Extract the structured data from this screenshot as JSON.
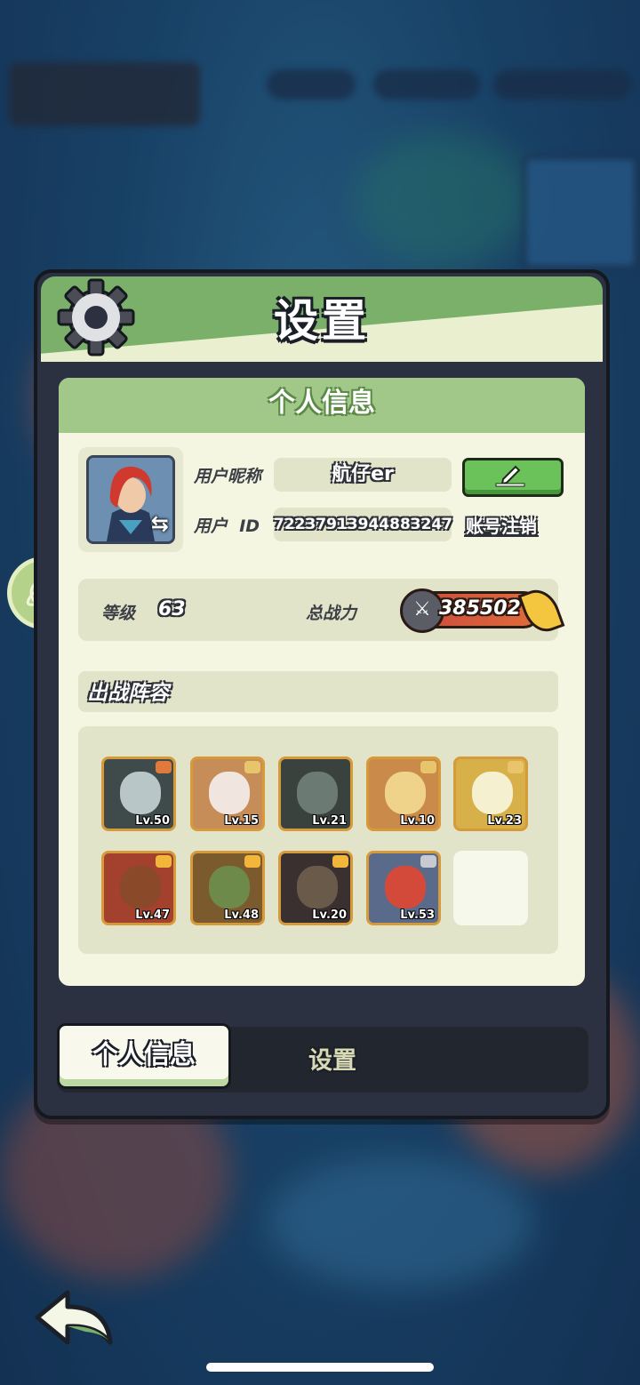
{
  "window": {
    "title": "设置"
  },
  "header": {
    "gear_icon": "gear-icon",
    "title": "设置"
  },
  "profile": {
    "section_title": "个人信息",
    "nickname_label": "用户昵称",
    "nickname_value": "航仔er",
    "userid_label": "用户  ID",
    "userid_value": "72237913944883247",
    "edit_icon": "pencil-icon",
    "cancel_account_label": "账号注销",
    "avatar_swap_icon": "swap-icon"
  },
  "stats": {
    "level_label": "等级",
    "level_value": "63",
    "power_label": "总战力",
    "power_value": "385502"
  },
  "lineup": {
    "title": "出战阵容",
    "heroes": [
      {
        "level": "Lv.50",
        "bg": "#3f4a4a",
        "face": "#b9c6c8",
        "badge": "#e07a3a"
      },
      {
        "level": "Lv.15",
        "bg": "#c78d58",
        "face": "#f1e6df",
        "badge": "#e8c46a"
      },
      {
        "level": "Lv.21",
        "bg": "#3a423e",
        "face": "#6b7a72",
        "badge": ""
      },
      {
        "level": "Lv.10",
        "bg": "#c98a4a",
        "face": "#efd38a",
        "badge": "#e8c46a"
      },
      {
        "level": "Lv.23",
        "bg": "#d8b04a",
        "face": "#f5f0d0",
        "badge": "#e8c46a"
      },
      {
        "level": "Lv.47",
        "bg": "#a3402e",
        "face": "#8a4a2a",
        "badge": "#f2b73a"
      },
      {
        "level": "Lv.48",
        "bg": "#7b5a2e",
        "face": "#6e8a4a",
        "badge": "#f2b73a"
      },
      {
        "level": "Lv.20",
        "bg": "#3a3030",
        "face": "#6a5a4a",
        "badge": "#f2b73a"
      },
      {
        "level": "Lv.53",
        "bg": "#5a6a8a",
        "face": "#d44a3a",
        "badge": "#c7cbd1"
      }
    ]
  },
  "tabs": [
    {
      "label": "个人信息",
      "active": true
    },
    {
      "label": "设置",
      "active": false
    }
  ],
  "colors": {
    "panel_green": "#7bb06a",
    "content_bg": "#f5f6e2",
    "field_bg": "#e2e4c9",
    "accent_green": "#6cc25a"
  }
}
